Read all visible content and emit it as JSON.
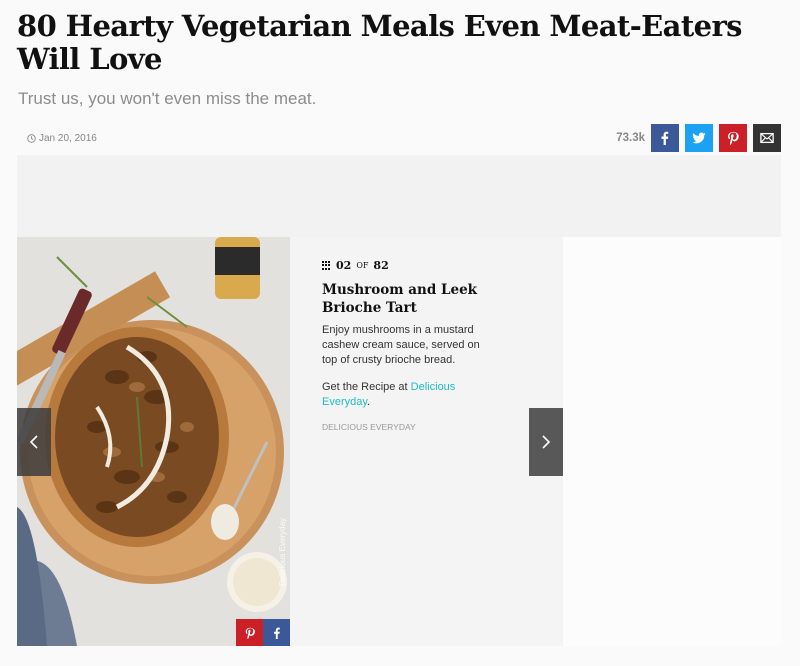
{
  "article": {
    "title": "80 Hearty Vegetarian Meals Even Meat-Eaters Will Love",
    "subtitle": "Trust us, you won't even miss the meat.",
    "date": "Jan 20, 2016",
    "share_count": "73.3k"
  },
  "share_buttons": [
    {
      "name": "facebook",
      "icon": "facebook-icon",
      "color": "#3b5998"
    },
    {
      "name": "twitter",
      "icon": "twitter-icon",
      "color": "#1da1f2"
    },
    {
      "name": "pinterest",
      "icon": "pinterest-icon",
      "color": "#cb2027"
    },
    {
      "name": "email",
      "icon": "email-icon",
      "color": "#333333"
    }
  ],
  "slide": {
    "current": "02",
    "of_label": "OF",
    "total": "82",
    "title": "Mushroom and Leek Brioche Tart",
    "description": "Enjoy mushrooms in a mustard cashew cream sauce, served on top of crusty brioche bread.",
    "link_prefix": "Get the Recipe at ",
    "link_text": "Delicious Everyday",
    "link_suffix": ".",
    "source": "DELICIOUS EVERYDAY",
    "photo_credit": "Delicious Everyday",
    "link_color": "#1fbcc0"
  },
  "navigation": {
    "prev_icon": "chevron-left-icon",
    "next_icon": "chevron-right-icon"
  }
}
